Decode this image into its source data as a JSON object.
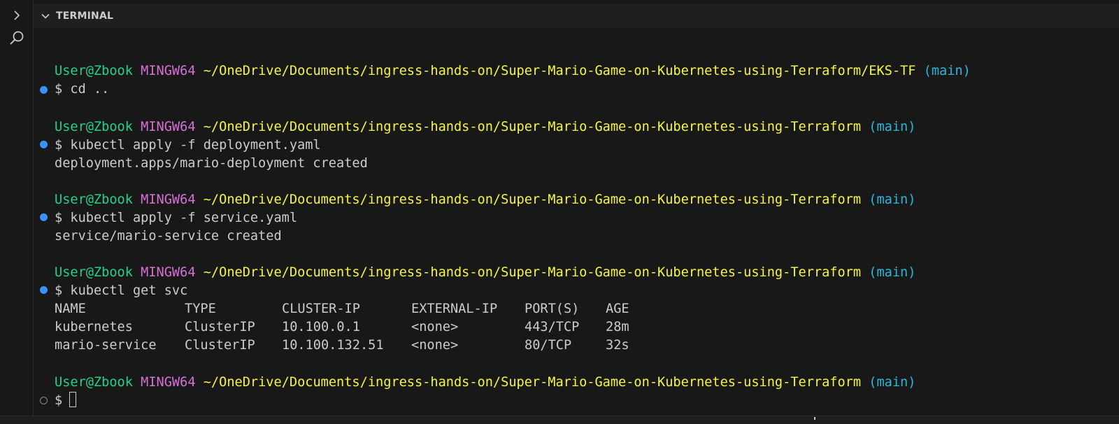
{
  "panel": {
    "title": "TERMINAL"
  },
  "prompt": {
    "user_host": "User@Zbook",
    "shell": "MINGW64",
    "path_eks": "~/OneDrive/Documents/ingress-hands-on/Super-Mario-Game-on-Kubernetes-using-Terraform/EKS-TF",
    "path_root": "~/OneDrive/Documents/ingress-hands-on/Super-Mario-Game-on-Kubernetes-using-Terraform",
    "branch": "(main)",
    "symbol": "$"
  },
  "commands": {
    "cd": "cd ..",
    "apply_deployment": "kubectl apply -f deployment.yaml",
    "apply_service": "kubectl apply -f service.yaml",
    "get_svc": "kubectl get svc"
  },
  "outputs": {
    "deployment_created": "deployment.apps/mario-deployment created",
    "service_created": "service/mario-service created"
  },
  "svc_table": {
    "headers": [
      "NAME",
      "TYPE",
      "CLUSTER-IP",
      "EXTERNAL-IP",
      "PORT(S)",
      "AGE"
    ],
    "rows": [
      [
        "kubernetes",
        "ClusterIP",
        "10.100.0.1",
        "<none>",
        "443/TCP",
        "28m"
      ],
      [
        "mario-service",
        "ClusterIP",
        "10.100.132.51",
        "<none>",
        "80/TCP",
        "32s"
      ]
    ]
  },
  "colors": {
    "background": "#181818",
    "user_host": "#23d18b",
    "shell": "#d670d6",
    "path": "#f5f543",
    "branch": "#29b8db",
    "success_decoration": "#3794ff"
  },
  "icons": {
    "chevron_right": "chevron-right-icon",
    "search": "search-icon",
    "collapse": "chevron-down-icon"
  }
}
